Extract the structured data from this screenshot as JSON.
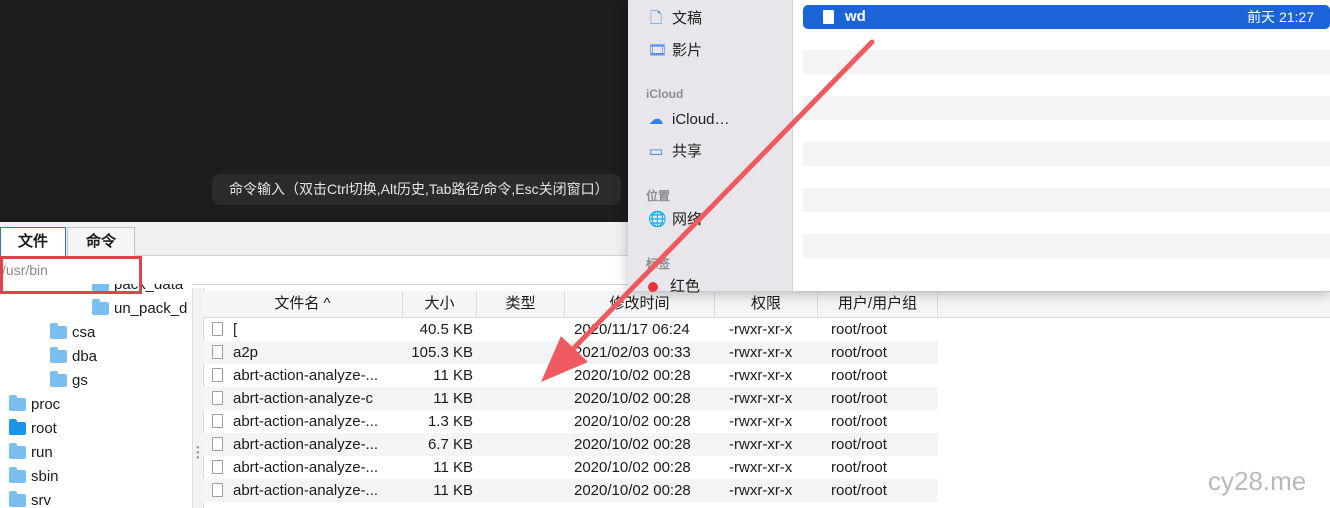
{
  "terminal": {
    "hint": "命令输入（双击Ctrl切换,Alt历史,Tab路径/命令,Esc关闭窗口）"
  },
  "tabs": [
    {
      "label": "文件",
      "active": true
    },
    {
      "label": "命令",
      "active": false
    }
  ],
  "path": "/usr/bin",
  "tree": {
    "items": [
      {
        "label": "pack_data",
        "level": 2
      },
      {
        "label": "un_pack_d",
        "level": 2
      },
      {
        "label": "csa",
        "level": 1
      },
      {
        "label": "dba",
        "level": 1
      },
      {
        "label": "gs",
        "level": 1
      },
      {
        "label": "proc",
        "level": 0
      },
      {
        "label": "root",
        "level": 0
      },
      {
        "label": "run",
        "level": 0
      },
      {
        "label": "sbin",
        "level": 0
      },
      {
        "label": "srv",
        "level": 0
      }
    ]
  },
  "table": {
    "columns": [
      "文件名 ^",
      "大小",
      "类型",
      "修改时间",
      "权限",
      "用户/用户组"
    ],
    "rows": [
      {
        "name": "[",
        "size": "40.5 KB",
        "mtime": "2020/11/17 06:24",
        "perm": "-rwxr-xr-x",
        "owner": "root/root"
      },
      {
        "name": "a2p",
        "size": "105.3 KB",
        "mtime": "2021/02/03 00:33",
        "perm": "-rwxr-xr-x",
        "owner": "root/root"
      },
      {
        "name": "abrt-action-analyze-...",
        "size": "11 KB",
        "mtime": "2020/10/02 00:28",
        "perm": "-rwxr-xr-x",
        "owner": "root/root"
      },
      {
        "name": "abrt-action-analyze-c",
        "size": "11 KB",
        "mtime": "2020/10/02 00:28",
        "perm": "-rwxr-xr-x",
        "owner": "root/root"
      },
      {
        "name": "abrt-action-analyze-...",
        "size": "1.3 KB",
        "mtime": "2020/10/02 00:28",
        "perm": "-rwxr-xr-x",
        "owner": "root/root"
      },
      {
        "name": "abrt-action-analyze-...",
        "size": "6.7 KB",
        "mtime": "2020/10/02 00:28",
        "perm": "-rwxr-xr-x",
        "owner": "root/root"
      },
      {
        "name": "abrt-action-analyze-...",
        "size": "11 KB",
        "mtime": "2020/10/02 00:28",
        "perm": "-rwxr-xr-x",
        "owner": "root/root"
      },
      {
        "name": "abrt-action-analyze-...",
        "size": "11 KB",
        "mtime": "2020/10/02 00:28",
        "perm": "-rwxr-xr-x",
        "owner": "root/root"
      }
    ]
  },
  "finder": {
    "sidebar": {
      "documents": "文稿",
      "movies": "影片",
      "icloud_head": "iCloud",
      "icloud_drive": "iCloud…",
      "shared": "共享",
      "locations_head": "位置",
      "network": "网络",
      "tags_head": "标签",
      "red_tag": "红色"
    },
    "selected_file": {
      "name": "wd",
      "date": "前天 21:27"
    }
  },
  "watermark": "cy28.me",
  "colors": {
    "selection": "#1b64d8",
    "annotation": "#e5414a",
    "active_tab": "#2f73d8"
  }
}
